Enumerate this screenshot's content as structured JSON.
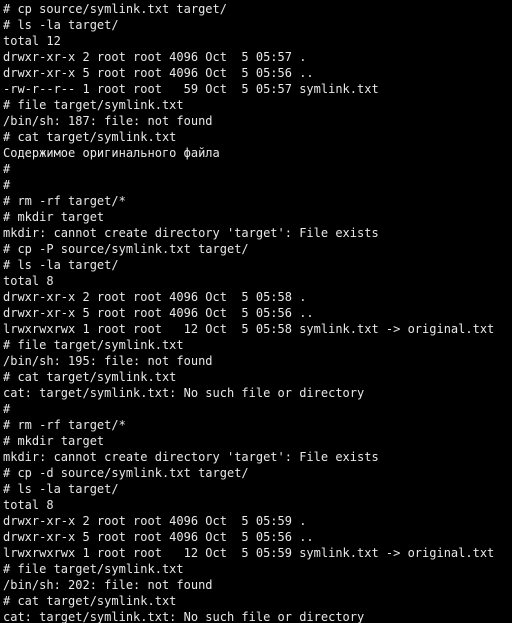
{
  "terminal": {
    "background": "#000000",
    "foreground": "#e8e8e8",
    "lines": [
      "# cp source/symlink.txt target/",
      "# ls -la target/",
      "total 12",
      "drwxr-xr-x 2 root root 4096 Oct  5 05:57 .",
      "drwxr-xr-x 5 root root 4096 Oct  5 05:56 ..",
      "-rw-r--r-- 1 root root   59 Oct  5 05:57 symlink.txt",
      "# file target/symlink.txt",
      "/bin/sh: 187: file: not found",
      "# cat target/symlink.txt",
      "Содержимое оригинального файла",
      "#",
      "#",
      "# rm -rf target/*",
      "# mkdir target",
      "mkdir: cannot create directory 'target': File exists",
      "# cp -P source/symlink.txt target/",
      "# ls -la target/",
      "total 8",
      "drwxr-xr-x 2 root root 4096 Oct  5 05:58 .",
      "drwxr-xr-x 5 root root 4096 Oct  5 05:56 ..",
      "lrwxrwxrwx 1 root root   12 Oct  5 05:58 symlink.txt -> original.txt",
      "# file target/symlink.txt",
      "/bin/sh: 195: file: not found",
      "# cat target/symlink.txt",
      "cat: target/symlink.txt: No such file or directory",
      "#",
      "# rm -rf target/*",
      "# mkdir target",
      "mkdir: cannot create directory 'target': File exists",
      "# cp -d source/symlink.txt target/",
      "# ls -la target/",
      "total 8",
      "drwxr-xr-x 2 root root 4096 Oct  5 05:59 .",
      "drwxr-xr-x 5 root root 4096 Oct  5 05:56 ..",
      "lrwxrwxrwx 1 root root   12 Oct  5 05:59 symlink.txt -> original.txt",
      "# file target/symlink.txt",
      "/bin/sh: 202: file: not found",
      "# cat target/symlink.txt",
      "cat: target/symlink.txt: No such file or directory"
    ]
  }
}
